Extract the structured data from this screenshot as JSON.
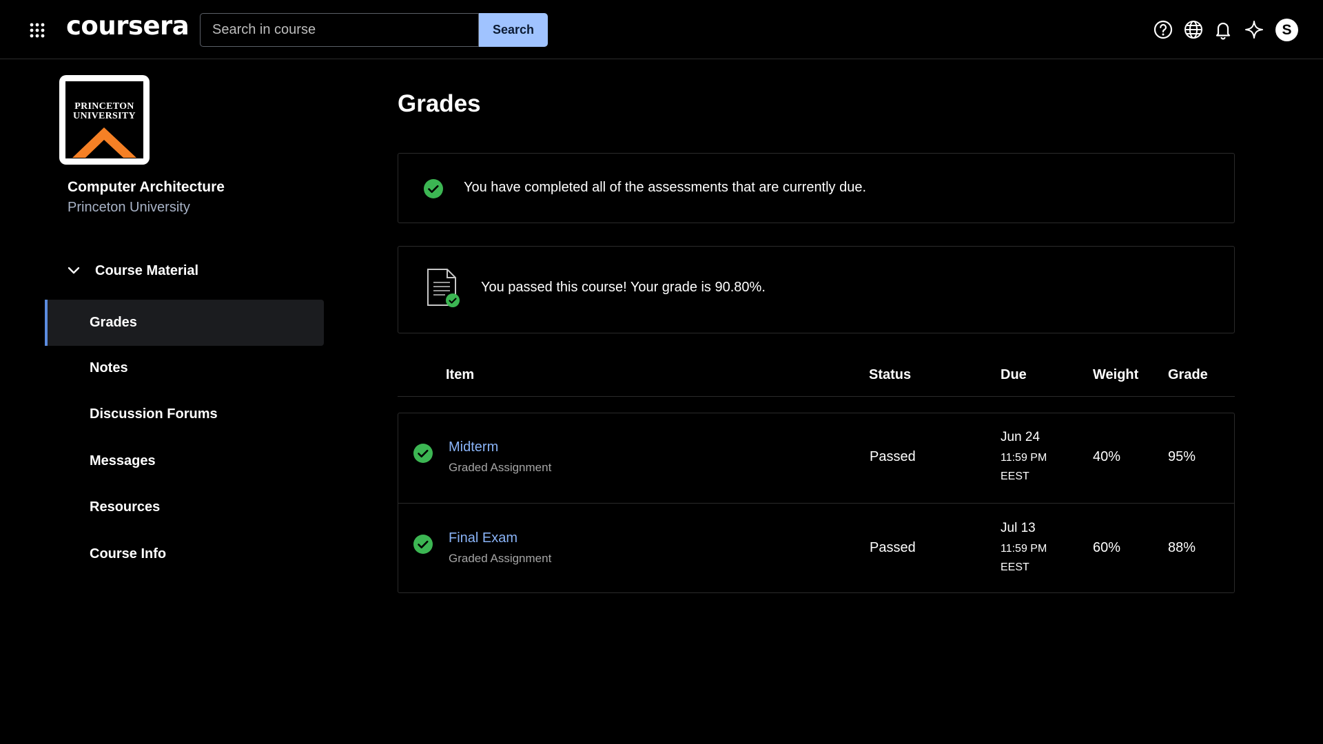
{
  "header": {
    "logo_text": "coursera",
    "search_placeholder": "Search in course",
    "search_button": "Search",
    "avatar_initial": "S",
    "icons": [
      "apps-grid-icon",
      "help-icon",
      "globe-icon",
      "bell-icon",
      "sparkle-icon"
    ]
  },
  "sidebar": {
    "university_logo_lines": [
      "PRINCETON",
      "UNIVERSITY"
    ],
    "course_title": "Computer Architecture",
    "course_org": "Princeton University",
    "section_label": "Course Material",
    "items": [
      {
        "label": "Grades",
        "active": true
      },
      {
        "label": "Notes",
        "active": false
      },
      {
        "label": "Discussion Forums",
        "active": false
      },
      {
        "label": "Messages",
        "active": false
      },
      {
        "label": "Resources",
        "active": false
      },
      {
        "label": "Course Info",
        "active": false
      }
    ]
  },
  "main": {
    "title": "Grades",
    "completion_message": "You have completed all of the assessments that are currently due.",
    "passed_message": "You passed this course! Your grade is 90.80%.",
    "table": {
      "headers": {
        "item": "Item",
        "status": "Status",
        "due": "Due",
        "weight": "Weight",
        "grade": "Grade"
      },
      "rows": [
        {
          "name": "Midterm",
          "type": "Graded Assignment",
          "status": "Passed",
          "due_date": "Jun 24",
          "due_time": "11:59 PM",
          "due_tz": "EEST",
          "weight": "40%",
          "grade": "95%"
        },
        {
          "name": "Final Exam",
          "type": "Graded Assignment",
          "status": "Passed",
          "due_date": "Jul 13",
          "due_time": "11:59 PM",
          "due_tz": "EEST",
          "weight": "60%",
          "grade": "88%"
        }
      ]
    }
  },
  "colors": {
    "accent_blue": "#a0c3ff",
    "link_blue": "#8ab4f8",
    "success_green": "#3cb653",
    "princeton_orange": "#f58025"
  }
}
